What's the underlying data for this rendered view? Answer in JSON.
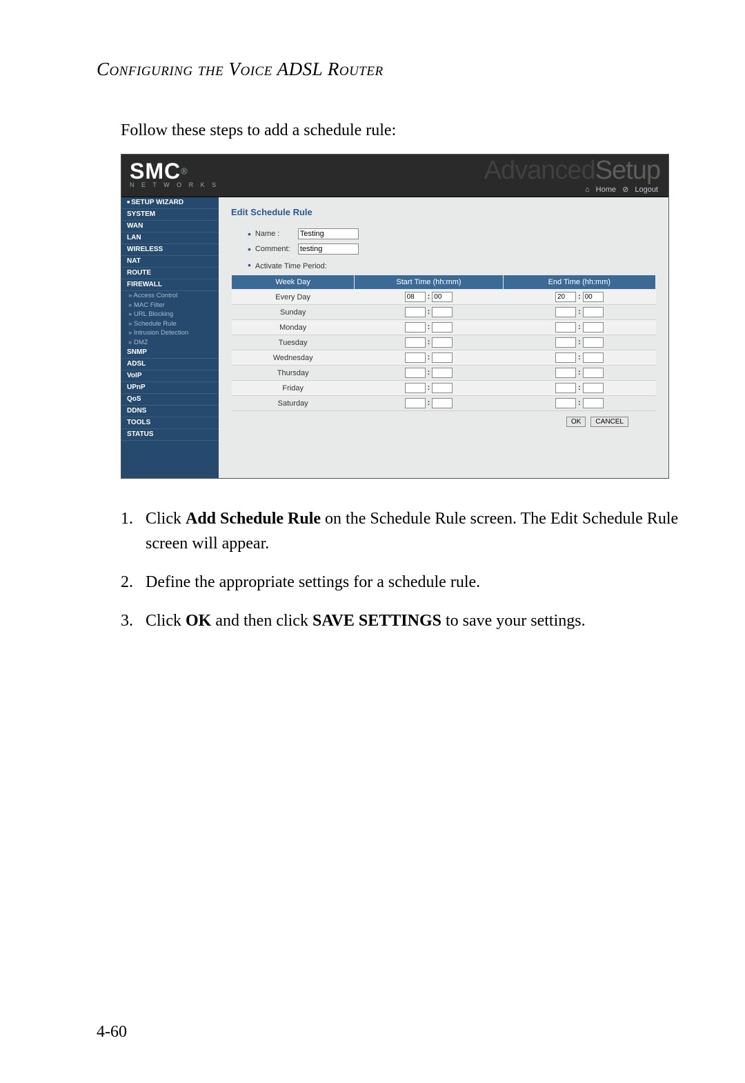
{
  "chapter_title": "Configuring the Voice ADSL Router",
  "intro_text": "Follow these steps to add a schedule rule:",
  "screenshot": {
    "logo": {
      "brand": "SMC",
      "reg": "®",
      "sub": "N E T W O R K S"
    },
    "banner": "AdvancedSetup",
    "toplinks": {
      "home": "Home",
      "logout": "Logout"
    },
    "sidebar": {
      "setup_wizard": "SETUP WIZARD",
      "system": "SYSTEM",
      "wan": "WAN",
      "lan": "LAN",
      "wireless": "WIRELESS",
      "nat": "NAT",
      "route": "ROUTE",
      "firewall": "FIREWALL",
      "sub_access": "Access Control",
      "sub_mac": "MAC Filter",
      "sub_url": "URL Blocking",
      "sub_schedule": "Schedule Rule",
      "sub_intrusion": "Intrusion Detection",
      "sub_dmz": "DMZ",
      "snmp": "SNMP",
      "adsl": "ADSL",
      "voip": "VoIP",
      "upnp": "UPnP",
      "qos": "QoS",
      "ddns": "DDNS",
      "tools": "TOOLS",
      "status": "STATUS"
    },
    "panel": {
      "title": "Edit Schedule Rule",
      "name_label": "Name :",
      "name_value": "Testing",
      "comment_label": "Comment:",
      "comment_value": "testing",
      "activate_label": "Activate Time Period:",
      "headers": {
        "weekday": "Week Day",
        "start": "Start Time (hh:mm)",
        "end": "End Time (hh:mm)"
      },
      "days": [
        "Every Day",
        "Sunday",
        "Monday",
        "Tuesday",
        "Wednesday",
        "Thursday",
        "Friday",
        "Saturday"
      ],
      "row0_start_h": "08",
      "row0_start_m": "00",
      "row0_end_h": "20",
      "row0_end_m": "00",
      "ok": "OK",
      "cancel": "CANCEL"
    }
  },
  "steps": {
    "s1_num": "1.",
    "s1_a": "Click ",
    "s1_b": "Add Schedule Rule",
    "s1_c": " on the Schedule Rule screen. The Edit Schedule Rule screen will appear.",
    "s2_num": "2.",
    "s2": "Define the appropriate settings for a schedule rule.",
    "s3_num": "3.",
    "s3_a": "Click ",
    "s3_b": "OK",
    "s3_c": " and then click ",
    "s3_d": "SAVE SETTINGS",
    "s3_e": " to save your settings."
  },
  "page_number": "4-60"
}
